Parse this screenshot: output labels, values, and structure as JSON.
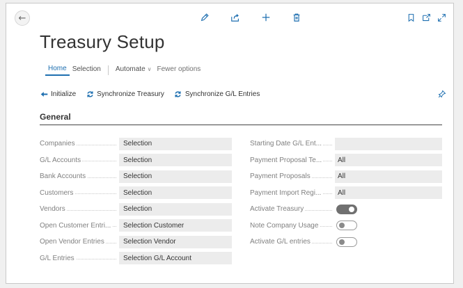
{
  "page": {
    "title": "Treasury Setup"
  },
  "toolbar_icons": [
    "edit-icon",
    "share-icon",
    "add-icon",
    "delete-icon"
  ],
  "window_icons": [
    "bookmark-icon",
    "open-new-window-icon",
    "expand-icon"
  ],
  "tabs": [
    {
      "label": "Home",
      "active": true
    },
    {
      "label": "Selection",
      "active": false
    },
    {
      "label": "Automate",
      "active": false
    },
    {
      "label": "Fewer options",
      "active": false
    }
  ],
  "actions": [
    {
      "label": "Initialize",
      "icon": "arrow-left-icon"
    },
    {
      "label": "Synchronize Treasury",
      "icon": "sync-icon"
    },
    {
      "label": "Synchronize G/L Entries",
      "icon": "sync-icon"
    }
  ],
  "section": {
    "title": "General"
  },
  "left_fields": [
    {
      "label": "Companies",
      "value": "Selection"
    },
    {
      "label": "G/L Accounts",
      "value": "Selection"
    },
    {
      "label": "Bank Accounts",
      "value": "Selection"
    },
    {
      "label": "Customers",
      "value": "Selection"
    },
    {
      "label": "Vendors",
      "value": "Selection"
    },
    {
      "label": "Open Customer Entri...",
      "value": "Selection Customer"
    },
    {
      "label": "Open Vendor Entries",
      "value": "Selection Vendor"
    },
    {
      "label": "G/L Entries",
      "value": "Selection G/L Account"
    }
  ],
  "right_fields": [
    {
      "label": "Starting Date G/L Ent...",
      "value": ""
    },
    {
      "label": "Payment Proposal Te...",
      "value": "All"
    },
    {
      "label": "Payment Proposals",
      "value": "All"
    },
    {
      "label": "Payment Import Regi...",
      "value": "All"
    }
  ],
  "toggles": [
    {
      "label": "Activate Treasury",
      "on": true
    },
    {
      "label": "Note Company Usage",
      "on": false
    },
    {
      "label": "Activate G/L entries",
      "on": false
    }
  ],
  "colors": {
    "accent": "#1e6fb0",
    "field_bg": "#ececec",
    "label": "#808080"
  }
}
